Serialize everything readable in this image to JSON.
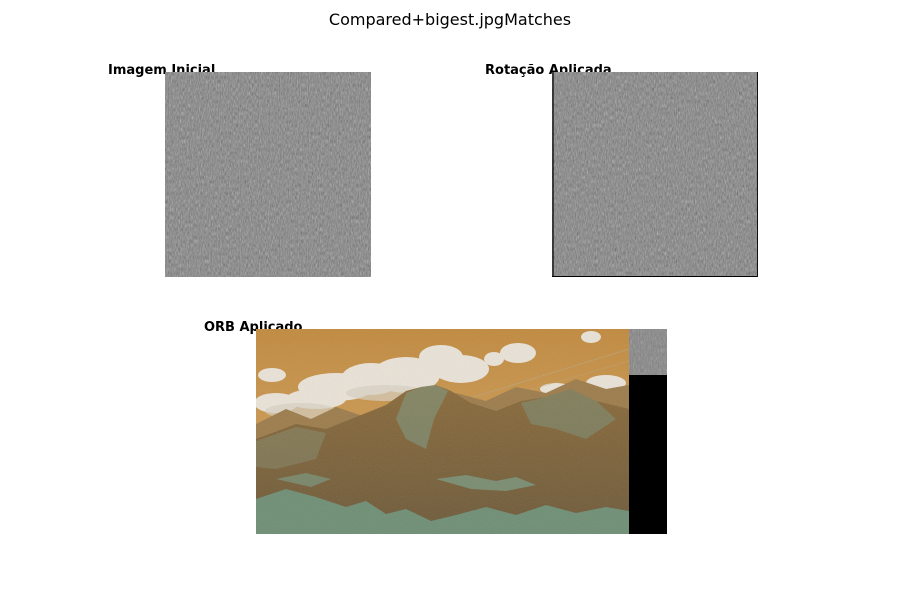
{
  "figure": {
    "title": "Compared+bigest.jpgMatches"
  },
  "panels": [
    {
      "id": "initial",
      "title": "Imagem Inicial"
    },
    {
      "id": "rotated",
      "title": "Rotação Aplicada"
    },
    {
      "id": "orb",
      "title": "ORB Aplicado"
    }
  ],
  "colors": {
    "noise_gray": "#808080",
    "sky_orange": "#c9954a",
    "cloud": "#ebe7df",
    "mountain_brown": "#7e6138",
    "vegetation_green": "#6f947c",
    "black_bar": "#000000"
  }
}
